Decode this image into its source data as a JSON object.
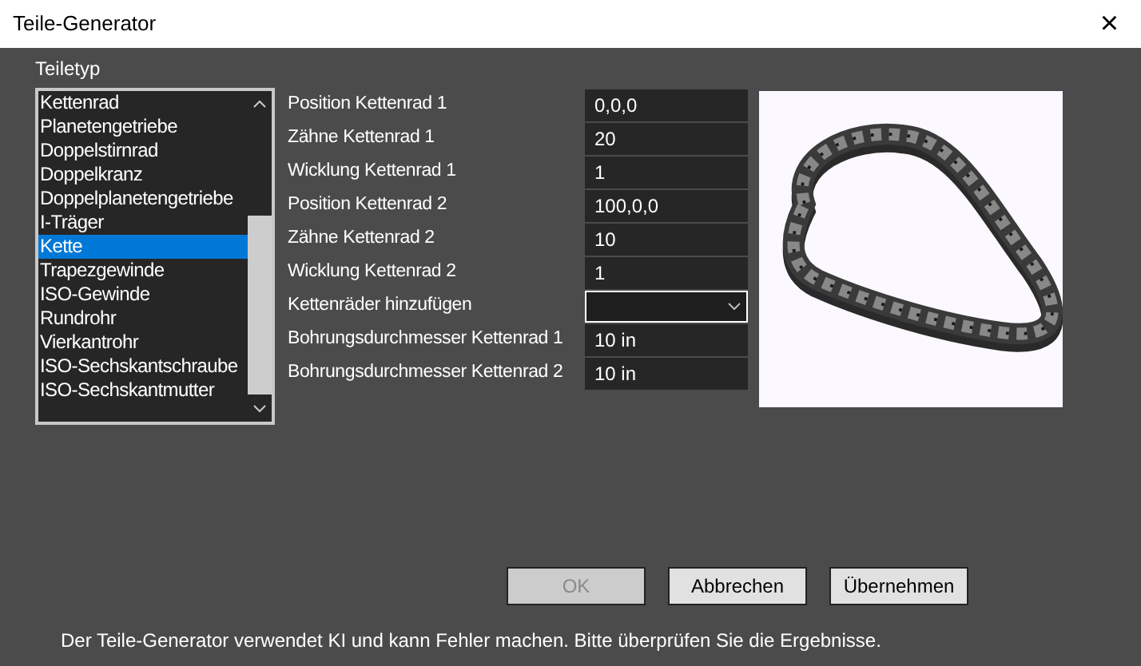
{
  "window": {
    "title": "Teile-Generator",
    "close": "×"
  },
  "part_type": {
    "label": "Teiletyp",
    "items": [
      {
        "label": "Kettenrad",
        "selected": false
      },
      {
        "label": "Planetengetriebe",
        "selected": false
      },
      {
        "label": "Doppelstirnrad",
        "selected": false
      },
      {
        "label": "Doppelkranz",
        "selected": false
      },
      {
        "label": "Doppelplanetengetriebe",
        "selected": false
      },
      {
        "label": "I-Träger",
        "selected": false
      },
      {
        "label": "Kette",
        "selected": true
      },
      {
        "label": "Trapezgewinde",
        "selected": false
      },
      {
        "label": "ISO-Gewinde",
        "selected": false
      },
      {
        "label": "Rundrohr",
        "selected": false
      },
      {
        "label": "Vierkantrohr",
        "selected": false
      },
      {
        "label": "ISO-Sechskantschraube",
        "selected": false
      },
      {
        "label": "ISO-Sechskantmutter",
        "selected": false
      }
    ]
  },
  "parameters": [
    {
      "kind": "text",
      "label": "Position Kettenrad 1",
      "value": "0,0,0"
    },
    {
      "kind": "text",
      "label": "Zähne Kettenrad 1",
      "value": "20"
    },
    {
      "kind": "text",
      "label": "Wicklung Kettenrad 1",
      "value": "1"
    },
    {
      "kind": "text",
      "label": "Position Kettenrad 2",
      "value": "100,0,0"
    },
    {
      "kind": "text",
      "label": "Zähne Kettenrad 2",
      "value": "10"
    },
    {
      "kind": "text",
      "label": "Wicklung Kettenrad 2",
      "value": "1"
    },
    {
      "kind": "dropdown",
      "label": "Kettenräder hinzufügen"
    },
    {
      "kind": "text",
      "label": "Bohrungsdurchmesser Kettenrad 1",
      "value": "10 in"
    },
    {
      "kind": "text",
      "label": "Bohrungsdurchmesser Kettenrad 2",
      "value": "10 in"
    }
  ],
  "buttons": [
    {
      "label": "OK",
      "disabled": true
    },
    {
      "label": "Abbrechen",
      "disabled": false
    },
    {
      "label": "Übernehmen",
      "disabled": false
    }
  ],
  "footer": "Der Teile-Generator verwendet KI und kann Fehler machen. Bitte überprüfen Sie die Ergebnisse."
}
